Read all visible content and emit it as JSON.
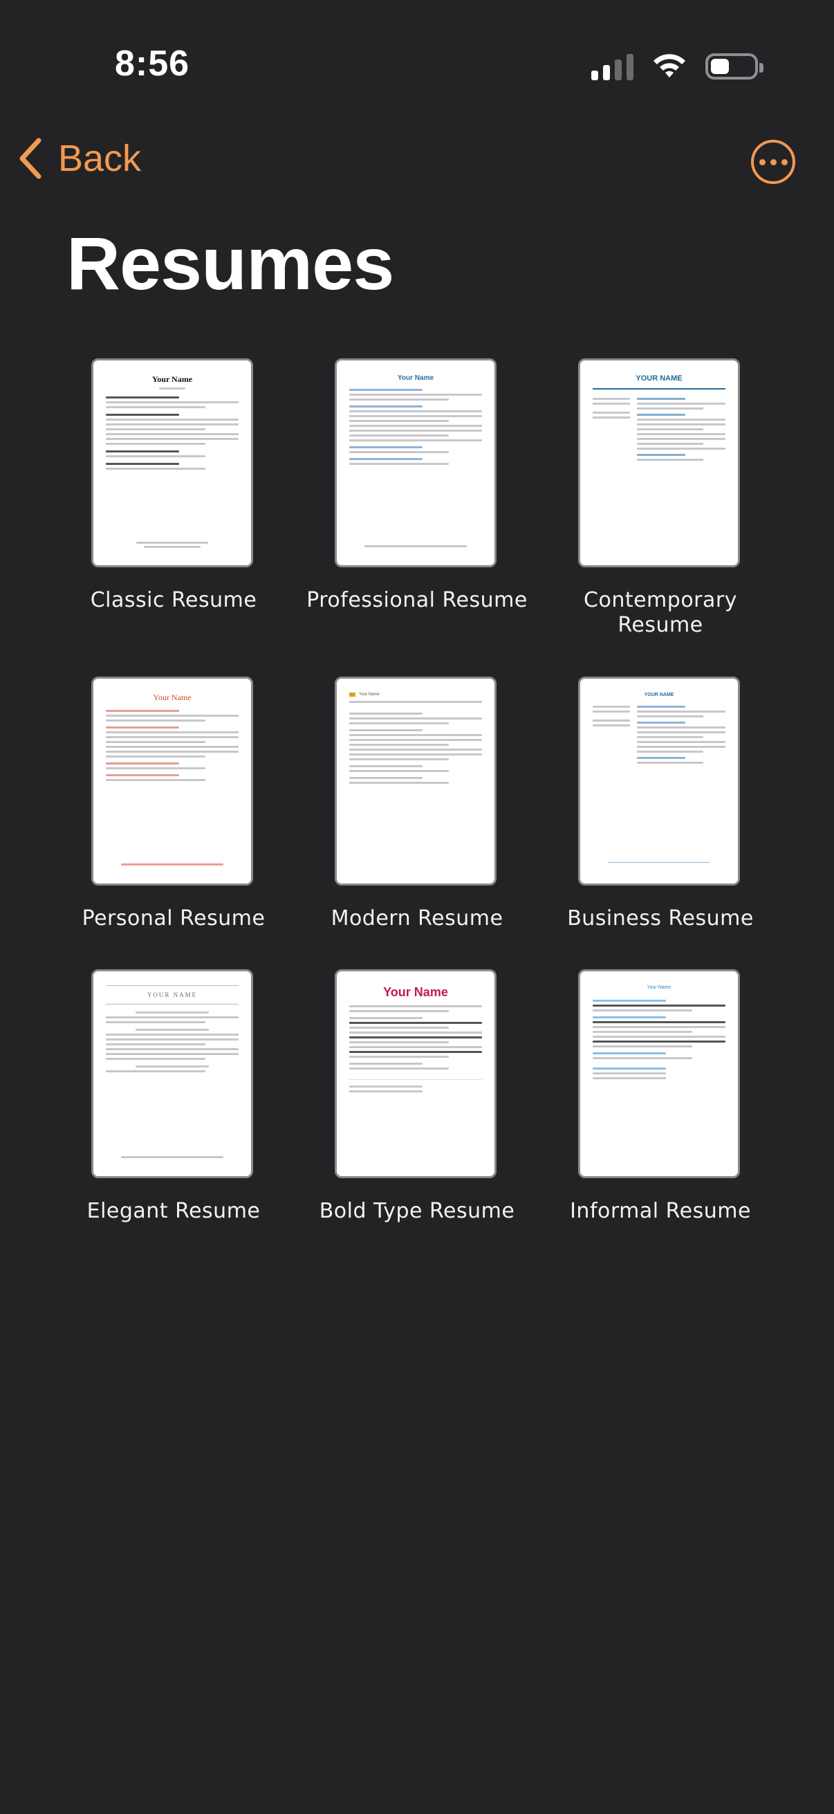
{
  "status_bar": {
    "time": "8:56"
  },
  "nav": {
    "back_label": "Back"
  },
  "page": {
    "title": "Resumes"
  },
  "templates": [
    {
      "label": "Classic Resume",
      "thumb_title": "Your Name",
      "style": "classic",
      "accent": "#222222"
    },
    {
      "label": "Professional Resume",
      "thumb_title": "Your Name",
      "style": "professional",
      "accent": "#2a6aa6"
    },
    {
      "label": "Contemporary Resume",
      "thumb_title": "YOUR NAME",
      "style": "contemporary",
      "accent": "#1f6c9a"
    },
    {
      "label": "Personal Resume",
      "thumb_title": "Your Name",
      "style": "personal",
      "accent": "#d04a28"
    },
    {
      "label": "Modern Resume",
      "thumb_title": "Your Name",
      "style": "modern",
      "accent": "#e0a21f"
    },
    {
      "label": "Business Resume",
      "thumb_title": "YOUR NAME",
      "style": "business",
      "accent": "#2a6aa6"
    },
    {
      "label": "Elegant Resume",
      "thumb_title": "YOUR NAME",
      "style": "elegant",
      "accent": "#6b6b6b"
    },
    {
      "label": "Bold Type Resume",
      "thumb_title": "Your Name",
      "style": "bold",
      "accent": "#c2185b"
    },
    {
      "label": "Informal Resume",
      "thumb_title": "Your Name",
      "style": "informal",
      "accent": "#2b8ad1"
    }
  ],
  "colors": {
    "background": "#232325",
    "accent": "#f19a52",
    "text": "#ffffff"
  }
}
